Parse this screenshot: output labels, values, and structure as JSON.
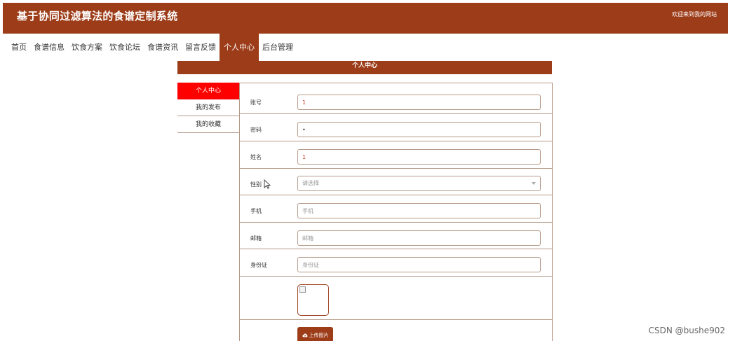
{
  "header": {
    "title": "基于协同过滤算法的食谱定制系统",
    "welcome": "欢迎来到我的网站"
  },
  "nav": {
    "items": [
      {
        "label": "首页"
      },
      {
        "label": "食谱信息"
      },
      {
        "label": "饮食方案"
      },
      {
        "label": "饮食论坛"
      },
      {
        "label": "食谱资讯"
      },
      {
        "label": "留言反馈"
      },
      {
        "label": "个人中心",
        "active": true
      },
      {
        "label": "后台管理"
      }
    ]
  },
  "section_title": "个人中心",
  "side_menu": {
    "items": [
      {
        "label": "个人中心",
        "active": true
      },
      {
        "label": "我的发布"
      },
      {
        "label": "我的收藏"
      }
    ]
  },
  "form": {
    "account": {
      "label": "账号",
      "value": "1"
    },
    "password": {
      "label": "密码",
      "value": "•"
    },
    "name": {
      "label": "姓名",
      "value": "1"
    },
    "gender": {
      "label": "性别",
      "placeholder": "请选择"
    },
    "phone": {
      "label": "手机",
      "placeholder": "手机"
    },
    "email": {
      "label": "邮箱",
      "placeholder": "邮箱"
    },
    "id_card": {
      "label": "身份证",
      "placeholder": "身份证"
    },
    "upload_label": "上传图片"
  },
  "watermark": "CSDN @bushe902",
  "colors": {
    "brand": "#9c3c18",
    "active_side": "#ff0000",
    "border": "#b59a88"
  }
}
